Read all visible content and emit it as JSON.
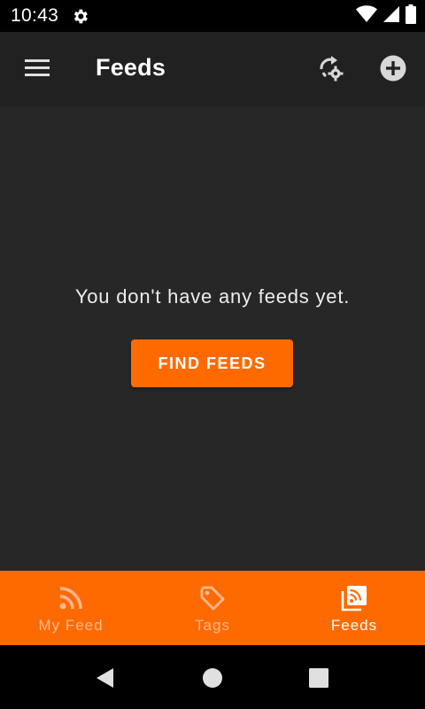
{
  "status_bar": {
    "time": "10:43",
    "icons": [
      "settings-icon",
      "wifi-icon",
      "signal-icon",
      "battery-icon"
    ]
  },
  "app_bar": {
    "title": "Feeds",
    "icons": [
      "menu-icon",
      "sync-settings-icon",
      "add-circle-icon"
    ]
  },
  "main": {
    "empty_message": "You don't have any feeds yet.",
    "find_button_label": "FIND FEEDS"
  },
  "bottom_nav": {
    "items": [
      {
        "label": "My Feed",
        "icon": "rss-icon",
        "active": false
      },
      {
        "label": "Tags",
        "icon": "tag-icon",
        "active": false
      },
      {
        "label": "Feeds",
        "icon": "feeds-library-icon",
        "active": true
      }
    ]
  },
  "system_nav": {
    "icons": [
      "back-icon",
      "home-icon",
      "recents-icon"
    ]
  },
  "colors": {
    "accent": "#ff6a00",
    "background": "#272727",
    "app_bar": "#212121",
    "inactive_nav": "#ffb890",
    "text": "#ffffff"
  }
}
